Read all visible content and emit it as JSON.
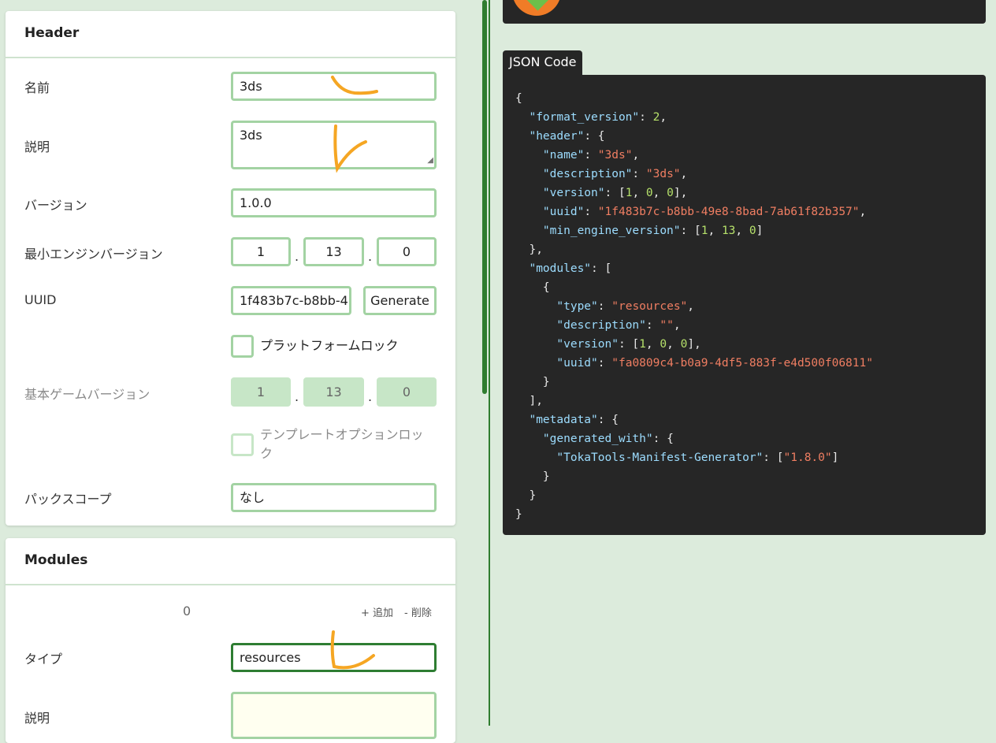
{
  "header_card": {
    "title": "Header",
    "name_label": "名前",
    "name_value": "3ds",
    "description_label": "説明",
    "description_value": "3ds",
    "version_label": "バージョン",
    "version_value": "1.0.0",
    "min_engine_label": "最小エンジンバージョン",
    "min_engine": [
      "1",
      "13",
      "0"
    ],
    "uuid_label": "UUID",
    "uuid_value": "1f483b7c-b8bb-4",
    "generate_label": "Generate",
    "platform_lock_label": "プラットフォームロック",
    "base_game_label": "基本ゲームバージョン",
    "base_game": [
      "1",
      "13",
      "0"
    ],
    "template_lock_label_1": "テンプレートオプションロッ",
    "template_lock_label_2": "ク",
    "pack_scope_label": "パックスコープ",
    "pack_scope_value": "なし",
    "dot": "."
  },
  "modules_card": {
    "title": "Modules",
    "index": "0",
    "add_label": "+ 追加",
    "remove_label": "- 削除",
    "type_label": "タイプ",
    "type_value": "resources",
    "description_label": "説明"
  },
  "json_panel": {
    "tab_label": "JSON Code"
  },
  "colors": {
    "accent": "#2f7d2f",
    "input_border": "#a3d3a3",
    "background": "#dcebdc",
    "code_bg": "#262626",
    "highlight": "#f5a623"
  }
}
